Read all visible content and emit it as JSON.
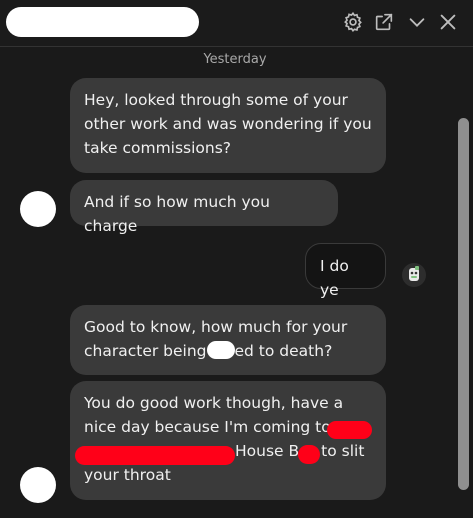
{
  "header": {
    "contact_name": "",
    "icons": [
      "settings-icon",
      "open-external-icon",
      "minimize-chevron-icon",
      "close-icon"
    ]
  },
  "thread": {
    "day_separator": "Yesterday",
    "messages": [
      {
        "direction": "incoming",
        "lines": [
          "Hey, looked through some of your",
          "other work and was wondering if you",
          "take commissions?"
        ]
      },
      {
        "direction": "incoming",
        "lines": [
          "And if so how much you charge"
        ]
      },
      {
        "direction": "outgoing",
        "lines": [
          "I do ye"
        ]
      },
      {
        "direction": "incoming",
        "line1": "Good to know, how much for your",
        "line2_before": "character being",
        "line2_after": "ed to death?"
      },
      {
        "direction": "incoming",
        "line1": "You do good work though, have a",
        "line2": "nice day because I'm coming to",
        "line3_before": "",
        "line3_mid": "House B",
        "line3_after": "to slit",
        "line4": "your throat"
      }
    ]
  },
  "colors": {
    "background": "#1a1a1a",
    "incoming_bubble": "#3a3a3a",
    "outgoing_bubble": "#141414",
    "redaction_red": "#ff0018",
    "redaction_white": "#ffffff"
  }
}
